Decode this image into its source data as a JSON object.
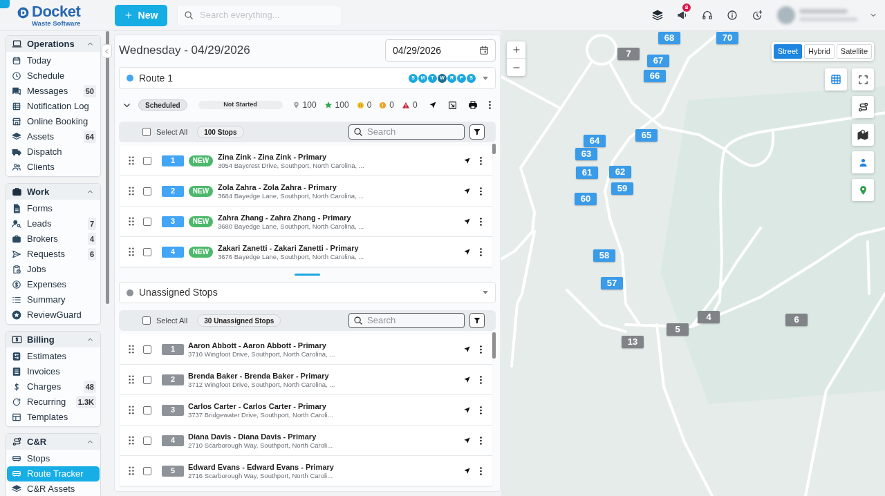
{
  "header": {
    "logo": {
      "title": "Docket",
      "subtitle": "Waste Software"
    },
    "new_button": "New",
    "search": {
      "placeholder": "Search everything..."
    },
    "announcements_badge": "8"
  },
  "sidebar": {
    "sections": [
      {
        "title": "Operations",
        "expanded": true,
        "items": [
          {
            "label": "Today",
            "selected": false
          },
          {
            "label": "Schedule",
            "selected": false
          },
          {
            "label": "Messages",
            "count": "50",
            "selected": false
          },
          {
            "label": "Notification Log",
            "selected": false
          },
          {
            "label": "Online Booking",
            "selected": false
          },
          {
            "label": "Assets",
            "count": "64",
            "selected": false
          },
          {
            "label": "Dispatch",
            "selected": false
          },
          {
            "label": "Clients",
            "selected": false
          }
        ]
      },
      {
        "title": "Work",
        "expanded": true,
        "items": [
          {
            "label": "Forms",
            "selected": false
          },
          {
            "label": "Leads",
            "count": "7",
            "selected": false
          },
          {
            "label": "Brokers",
            "count": "4",
            "selected": false
          },
          {
            "label": "Requests",
            "count": "6",
            "selected": false
          },
          {
            "label": "Jobs",
            "selected": false
          },
          {
            "label": "Expenses",
            "selected": false
          },
          {
            "label": "Summary",
            "selected": false
          },
          {
            "label": "ReviewGuard",
            "selected": false
          }
        ]
      },
      {
        "title": "Billing",
        "expanded": true,
        "items": [
          {
            "label": "Estimates",
            "selected": false
          },
          {
            "label": "Invoices",
            "selected": false
          },
          {
            "label": "Charges",
            "count": "48",
            "selected": false
          },
          {
            "label": "Recurring",
            "count": "1.3K",
            "selected": false
          },
          {
            "label": "Templates",
            "selected": false
          }
        ]
      },
      {
        "title": "C&R",
        "expanded": true,
        "items": [
          {
            "label": "Stops",
            "selected": false
          },
          {
            "label": "Route Tracker",
            "selected": true
          },
          {
            "label": "C&R Assets",
            "selected": false
          }
        ]
      }
    ]
  },
  "route_panel": {
    "heading": "Wednesday - 04/29/2026",
    "date_field": {
      "value": "04/29/2026"
    },
    "route": {
      "name": "Route 1",
      "color": "#42a5f5",
      "days": [
        {
          "label": "S",
          "selected": false
        },
        {
          "label": "M",
          "selected": false
        },
        {
          "label": "T",
          "selected": false
        },
        {
          "label": "W",
          "selected": true
        },
        {
          "label": "R",
          "selected": false
        },
        {
          "label": "F",
          "selected": false
        },
        {
          "label": "S",
          "selected": false
        }
      ],
      "status": "Scheduled",
      "progress_label": "Not Started",
      "stats": [
        {
          "kind": "stops",
          "value": "100"
        },
        {
          "kind": "completed",
          "value": "100"
        },
        {
          "kind": "paused",
          "value": "0"
        },
        {
          "kind": "warning",
          "value": "0"
        },
        {
          "kind": "alert",
          "value": "0"
        }
      ],
      "toolbar": {
        "select_all": "Select All",
        "select_all_checked": false,
        "count": "100 Stops",
        "search": {
          "placeholder": "Search"
        }
      },
      "stops": [
        {
          "number": "1",
          "badge": "NEW",
          "name": "Zina Zink - Zina Zink - Primary",
          "address": "3054 Baycrest Drive, Southport, North Carolina, ...",
          "checked": false
        },
        {
          "number": "2",
          "badge": "NEW",
          "name": "Zola Zahra - Zola Zahra - Primary",
          "address": "3684 Bayedge Lane, Southport, North Carolina, ...",
          "checked": false
        },
        {
          "number": "3",
          "badge": "NEW",
          "name": "Zahra Zhang - Zahra Zhang - Primary",
          "address": "3680 Bayedge Lane, Southport, North Carolina, ...",
          "checked": false
        },
        {
          "number": "4",
          "badge": "NEW",
          "name": "Zakari Zanetti - Zakari Zanetti - Primary",
          "address": "3676 Bayedge Lane, Southport, North Carolina, ...",
          "checked": false
        }
      ]
    },
    "unassigned": {
      "name": "Unassigned Stops",
      "color": "#8e9399",
      "toolbar": {
        "select_all": "Select All",
        "select_all_checked": false,
        "count": "30 Unassigned Stops",
        "search": {
          "placeholder": "Search"
        }
      },
      "stops": [
        {
          "number": "1",
          "name": "Aaron Abbott - Aaron Abbott - Primary",
          "address": "3710 Wingfoot Drive, Southport, North Carolina, ...",
          "checked": false
        },
        {
          "number": "2",
          "name": "Brenda Baker - Brenda Baker - Primary",
          "address": "3712 Wingfoot Drive, Southport, North Carolina, ...",
          "checked": false
        },
        {
          "number": "3",
          "name": "Carlos Carter - Carlos Carter - Primary",
          "address": "3737 Bridgewater Drive, Southport, North Caroli...",
          "checked": false
        },
        {
          "number": "4",
          "name": "Diana Davis - Diana Davis - Primary",
          "address": "2710 Scarborough Way, Southport, North Caroli...",
          "checked": false
        },
        {
          "number": "5",
          "name": "Edward Evans - Edward Evans - Primary",
          "address": "2716 Scarborough Way, Southport, North Caroli...",
          "checked": false
        }
      ]
    }
  },
  "map": {
    "map_types": [
      {
        "label": "Street",
        "selected": true
      },
      {
        "label": "Hybrid",
        "selected": false
      },
      {
        "label": "Satellite",
        "selected": false
      }
    ],
    "markers": [
      {
        "label": "68",
        "color": "#3a9be8"
      },
      {
        "label": "70",
        "color": "#3a9be8"
      },
      {
        "label": "7",
        "color": "#808488"
      },
      {
        "label": "67",
        "color": "#3a9be8"
      },
      {
        "label": "66",
        "color": "#3a9be8"
      },
      {
        "label": "65",
        "color": "#3a9be8"
      },
      {
        "label": "64",
        "color": "#3a9be8"
      },
      {
        "label": "63",
        "color": "#3a9be8"
      },
      {
        "label": "62",
        "color": "#3a9be8"
      },
      {
        "label": "61",
        "color": "#3a9be8"
      },
      {
        "label": "59",
        "color": "#3a9be8"
      },
      {
        "label": "60",
        "color": "#3a9be8"
      },
      {
        "label": "58",
        "color": "#3a9be8"
      },
      {
        "label": "57",
        "color": "#3a9be8"
      },
      {
        "label": "4",
        "color": "#808488"
      },
      {
        "label": "6",
        "color": "#808488"
      },
      {
        "label": "5",
        "color": "#808488"
      },
      {
        "label": "13",
        "color": "#808488"
      }
    ]
  }
}
